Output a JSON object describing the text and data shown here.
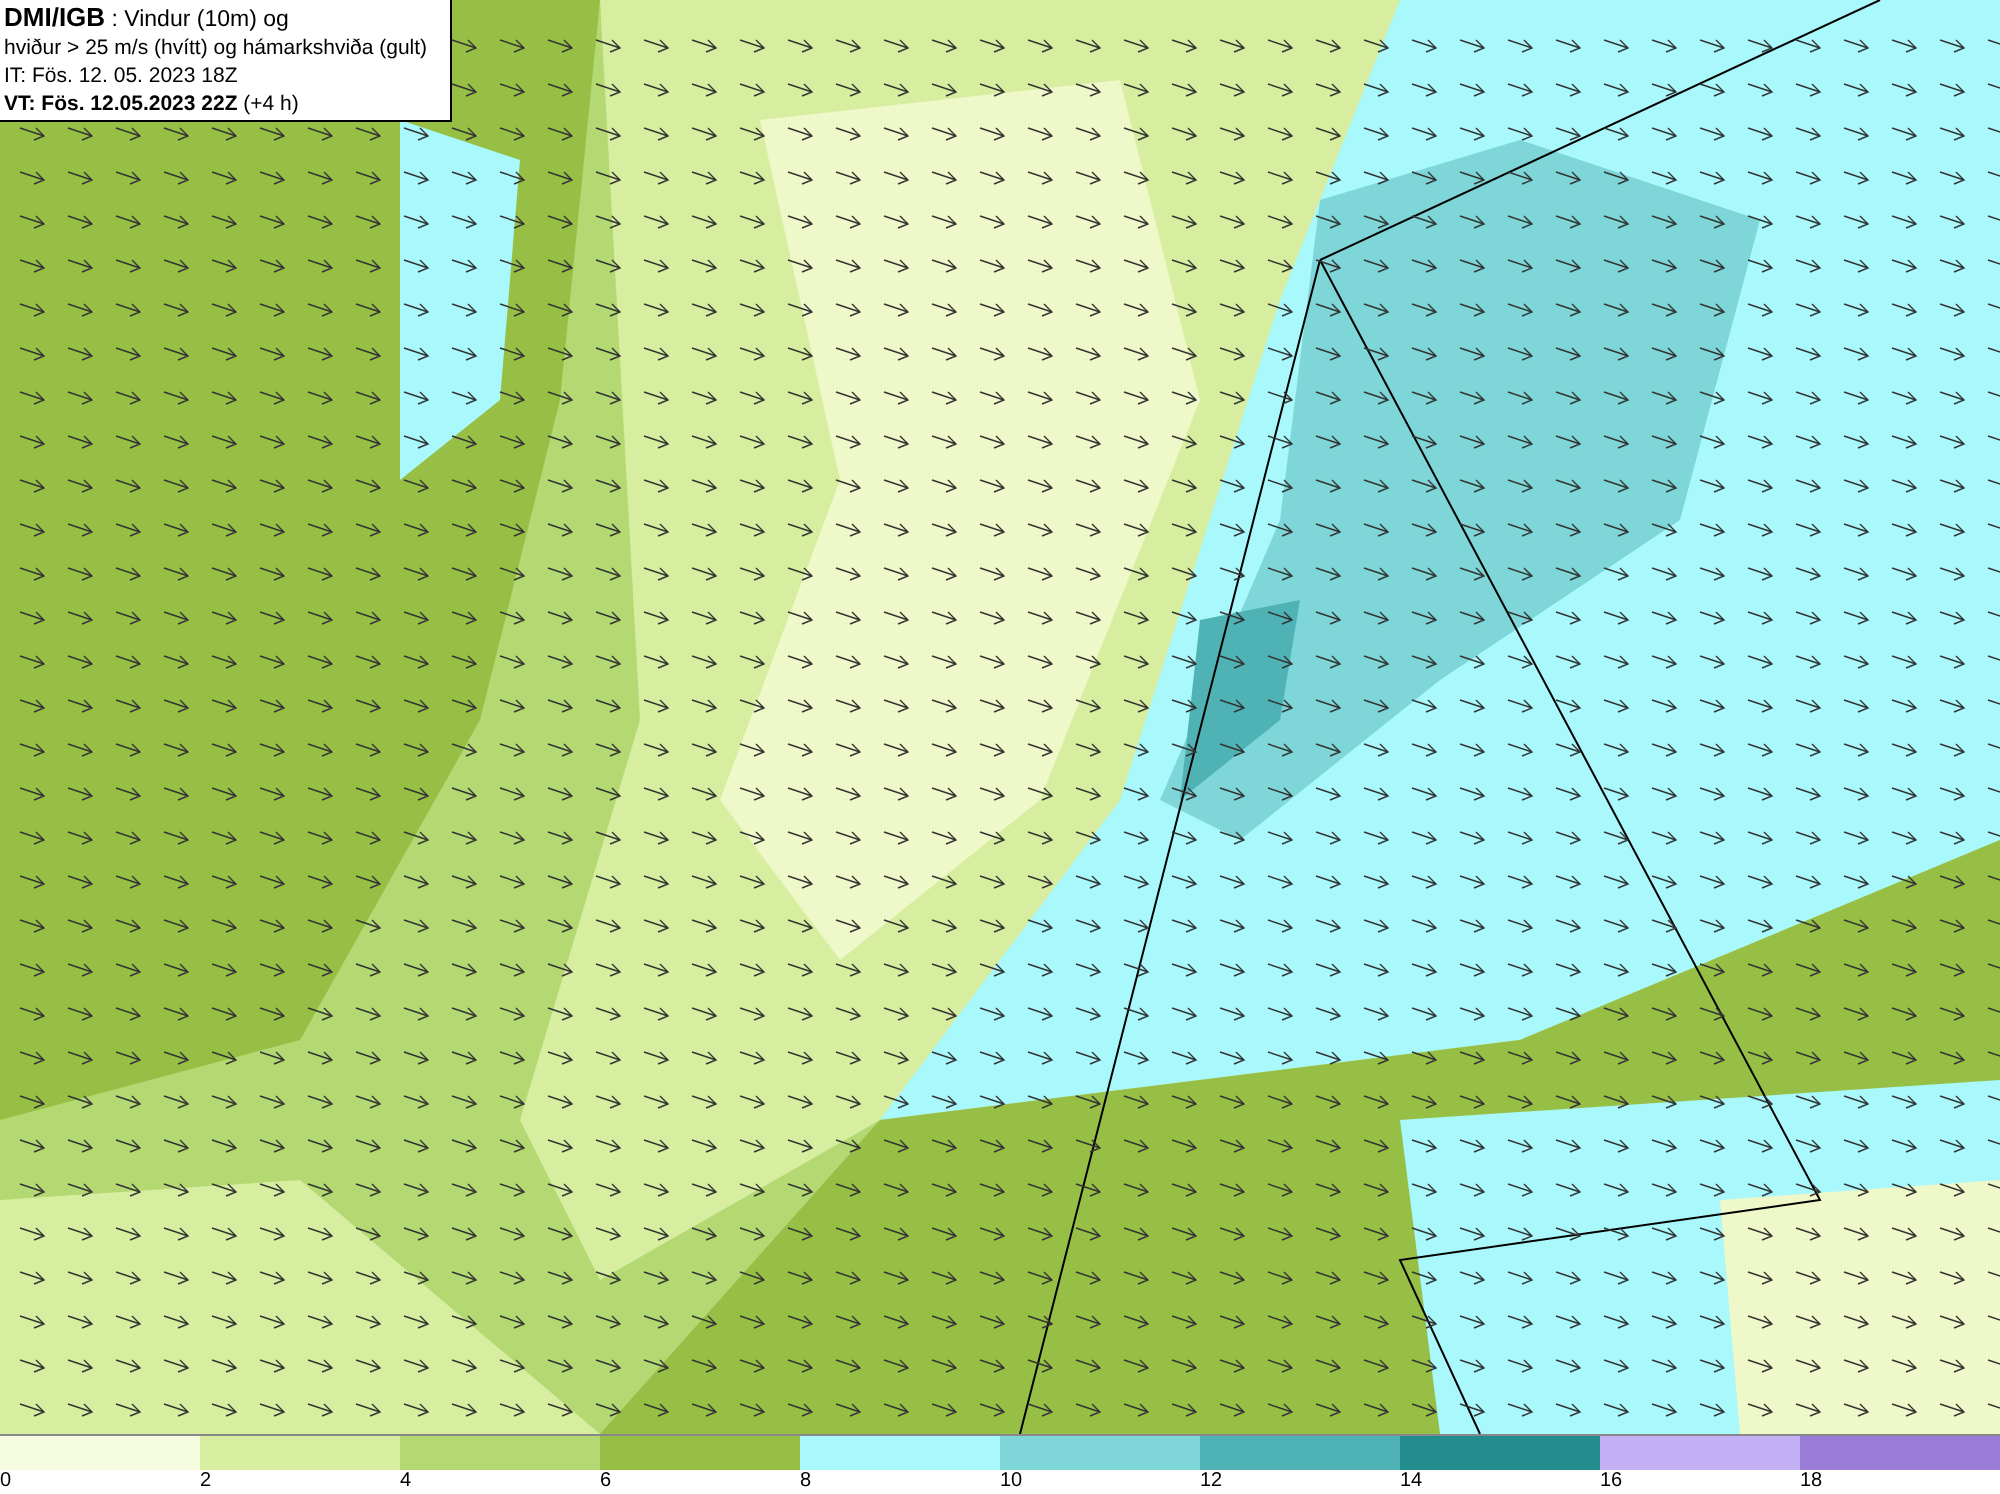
{
  "header": {
    "lines": [
      "**DMI/IGB** : Vindur (10m) og",
      "hviður > 25 m/s (hvítt) og hámarkshviða (gult)",
      "IT: Fös. 12. 05. 2023 18Z",
      "**VT: Fös. 12.05.2023 22Z** (+4 h)"
    ]
  },
  "legend": {
    "segments": [
      {
        "label": "0",
        "color": "#f5fce0"
      },
      {
        "label": "2",
        "color": "#d7eea0"
      },
      {
        "label": "4",
        "color": "#b4d872"
      },
      {
        "label": "6",
        "color": "#97bf45"
      },
      {
        "label": "8",
        "color": "#a8f8fc"
      },
      {
        "label": "10",
        "color": "#7ed6d8"
      },
      {
        "label": "12",
        "color": "#4fb2b5"
      },
      {
        "label": "14",
        "color": "#238c8c"
      },
      {
        "label": "16",
        "color": "#c3b0f5"
      },
      {
        "label": "18",
        "color": "#9a7bd8"
      }
    ]
  }
}
